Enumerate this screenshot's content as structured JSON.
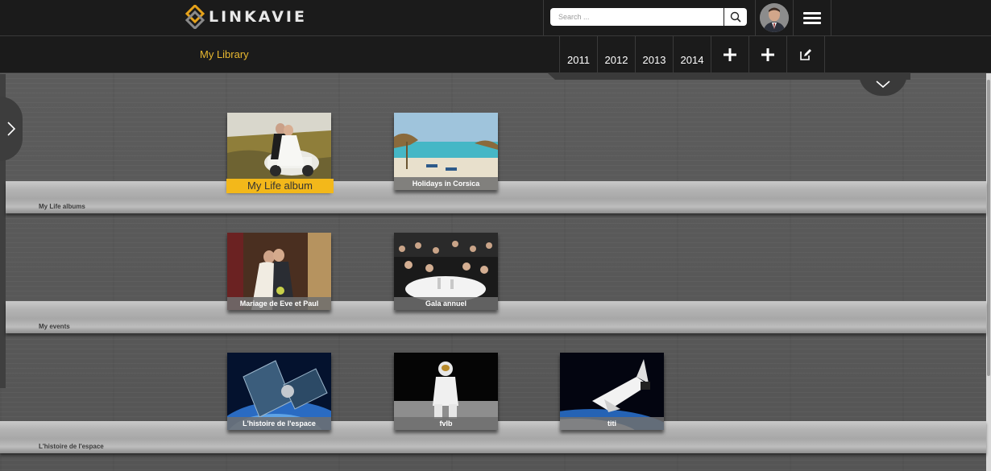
{
  "header": {
    "logo_text": "LINKAVIE",
    "search_placeholder": "Search ...",
    "menu_icon": "hamburger-icon",
    "search_icon": "magnifier-icon"
  },
  "subheader": {
    "title": "My Library",
    "years": [
      "2011",
      "2012",
      "2013",
      "2014"
    ],
    "actions": [
      "add-icon",
      "add-icon",
      "edit-icon"
    ]
  },
  "shelves": [
    {
      "label": "My Life albums",
      "albums": [
        {
          "title": "My Life album",
          "selected": true
        },
        {
          "title": "Holidays in Corsica",
          "selected": false
        }
      ]
    },
    {
      "label": "My events",
      "albums": [
        {
          "title": "Mariage de Eve et Paul",
          "selected": false
        },
        {
          "title": "Gala annuel",
          "selected": false
        }
      ]
    },
    {
      "label": "L'histoire de l'espace",
      "albums": [
        {
          "title": "L'histoire de l'espace",
          "selected": false
        },
        {
          "title": "fvlb",
          "selected": false
        },
        {
          "title": "titi",
          "selected": false
        }
      ]
    }
  ],
  "colors": {
    "accent": "#e8b830",
    "selected_caption": "#f3b81a",
    "background": "#1b1b1b"
  }
}
